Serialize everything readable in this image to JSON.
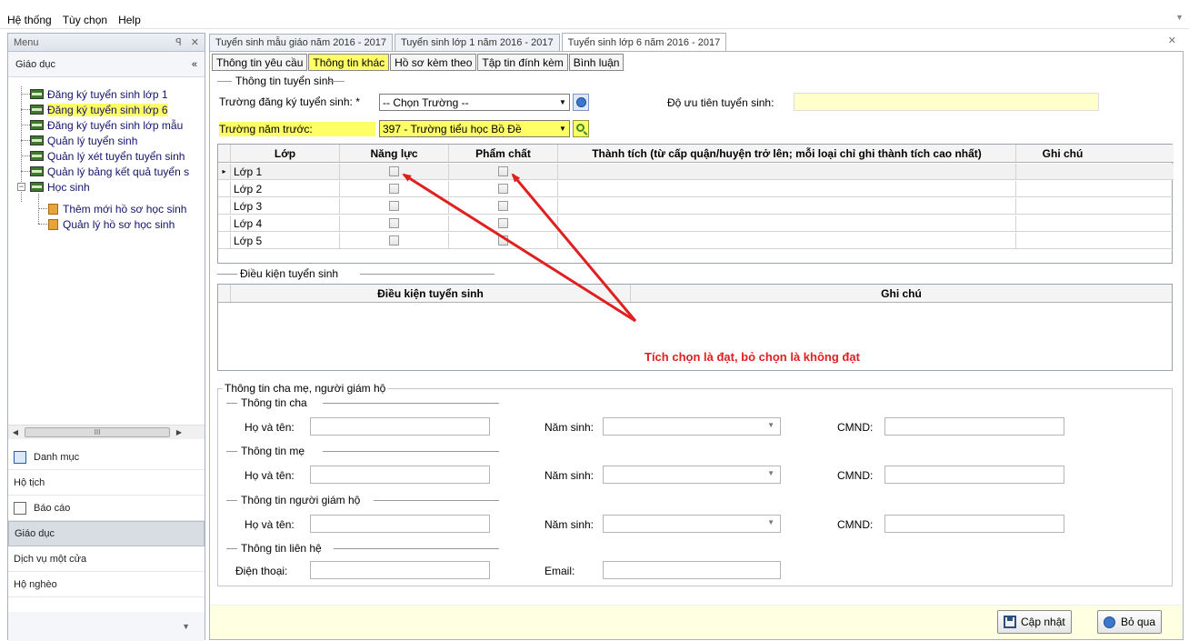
{
  "menubar": {
    "items": [
      "Hệ thống",
      "Tùy chọn",
      "Help"
    ]
  },
  "sidebar": {
    "title": "Menu",
    "section": "Giáo dục",
    "tree": [
      {
        "label": "Đăng ký tuyển sinh lớp 1"
      },
      {
        "label": "Đăng ký tuyển sinh lớp 6"
      },
      {
        "label": "Đăng ký tuyển sinh lớp mẫu"
      },
      {
        "label": "Quản lý tuyển sinh"
      },
      {
        "label": "Quản lý xét tuyển tuyển sinh"
      },
      {
        "label": "Quản lý bảng kết quả tuyển s"
      },
      {
        "label": "Học sinh"
      },
      {
        "label": "Thêm mới hồ sơ học sinh"
      },
      {
        "label": "Quản lý hồ sơ học sinh"
      }
    ],
    "scroll_thumb": "III",
    "nav": [
      "Danh mục",
      "Hộ tịch",
      "Báo cáo",
      "Giáo dục",
      "Dịch vụ một cửa",
      "Hộ nghèo"
    ]
  },
  "doc_tabs": [
    "Tuyển sinh mẫu giáo năm 2016 - 2017",
    "Tuyển sinh lớp 1 năm 2016 - 2017",
    "Tuyển sinh lớp 6 năm 2016 - 2017"
  ],
  "sub_tabs": [
    "Thông tin yêu cầu",
    "Thông tin khác",
    "Hồ sơ kèm theo",
    "Tập tin đính kèm",
    "Bình luận"
  ],
  "admission": {
    "legend": "Thông tin tuyển sinh",
    "school_label": "Trường đăng ký tuyển sinh: *",
    "school_value": "-- Chọn Trường --",
    "priority_label": "Độ ưu tiên tuyển sinh:",
    "prev_school_label": "Trường năm trước:",
    "prev_school_value": "397 - Trường tiểu học Bồ Đề"
  },
  "grades_grid": {
    "headers": [
      "Lớp",
      "Năng lực",
      "Phẩm chất",
      "Thành tích (từ cấp quận/huyện trở lên; mỗi loại chỉ ghi thành tích cao nhất)",
      "Ghi chú"
    ],
    "rows": [
      {
        "class": "Lớp 1",
        "indicator": "▸"
      },
      {
        "class": "Lớp 2",
        "indicator": ""
      },
      {
        "class": "Lớp 3",
        "indicator": ""
      },
      {
        "class": "Lớp 4",
        "indicator": ""
      },
      {
        "class": "Lớp 5",
        "indicator": ""
      }
    ]
  },
  "conditions": {
    "legend": "Điều kiện tuyển sinh",
    "headers": [
      "Điều kiện tuyển sinh",
      "Ghi chú"
    ]
  },
  "annotation": "Tích chọn là đạt, bỏ chọn là không đạt",
  "parents": {
    "legend": "Thông tin cha mẹ, người giám hộ",
    "father": "Thông tin cha",
    "mother": "Thông tin mẹ",
    "guardian": "Thông tin người giám hộ",
    "contact": "Thông tin liên hệ",
    "name_label": "Họ và tên:",
    "birth_label": "Năm sinh:",
    "id_label": "CMND:",
    "phone_label": "Điện thoại:",
    "email_label": "Email:"
  },
  "footer": {
    "save": "Cập nhật",
    "cancel": "Bỏ qua"
  },
  "colors": {
    "highlight": "#ffff66",
    "annotation": "#e0201f",
    "footer_bg": "#ffffe1"
  }
}
